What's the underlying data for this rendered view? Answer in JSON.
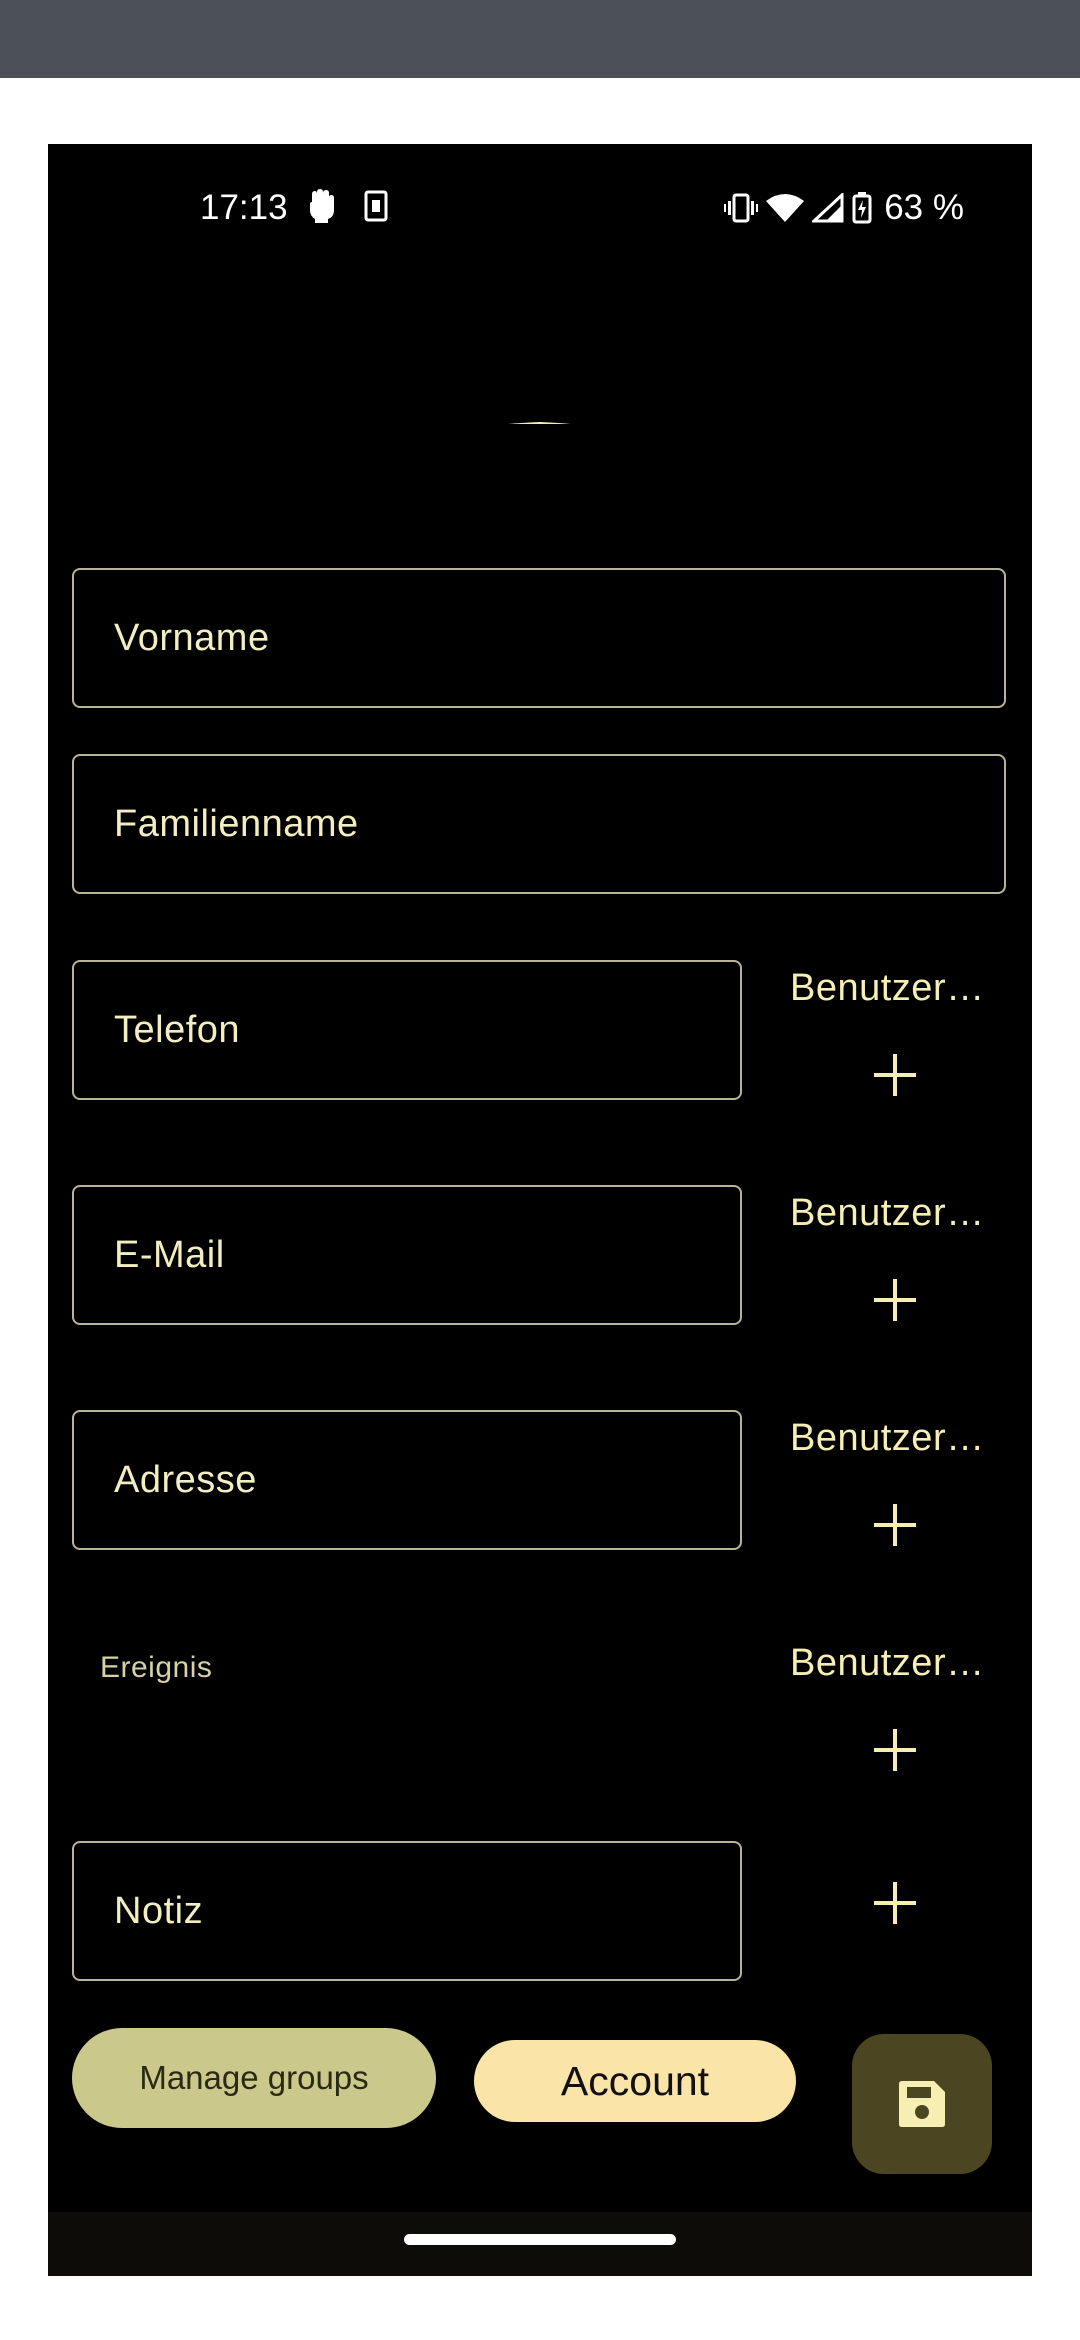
{
  "status_bar": {
    "time": "17:13",
    "battery": "63 %",
    "left_icons": [
      "hand-icon",
      "sim-icon"
    ],
    "right_icons": [
      "vibrate-icon",
      "wifi-icon",
      "signal-icon",
      "battery-charging-icon"
    ]
  },
  "avatar": {
    "icon": "person-avatar-icon"
  },
  "form": {
    "first_name_placeholder": "Vorname",
    "last_name_placeholder": "Familienname",
    "phone_placeholder": "Telefon",
    "phone_type": "Benutzer…",
    "email_placeholder": "E-Mail",
    "email_type": "Benutzer…",
    "address_placeholder": "Adresse",
    "address_type": "Benutzer…",
    "event_label": "Ereignis",
    "event_type": "Benutzer…",
    "note_placeholder": "Notiz"
  },
  "actions": {
    "manage_groups": "Manage groups",
    "account": "Account",
    "save_icon": "save-icon"
  },
  "colors": {
    "background": "#000000",
    "accent": "#f6eeb2",
    "field_border": "#b8b497",
    "manage_groups_bg": "#cac98b",
    "account_bg": "#fbe4a8",
    "fab_bg": "#4b4621"
  }
}
